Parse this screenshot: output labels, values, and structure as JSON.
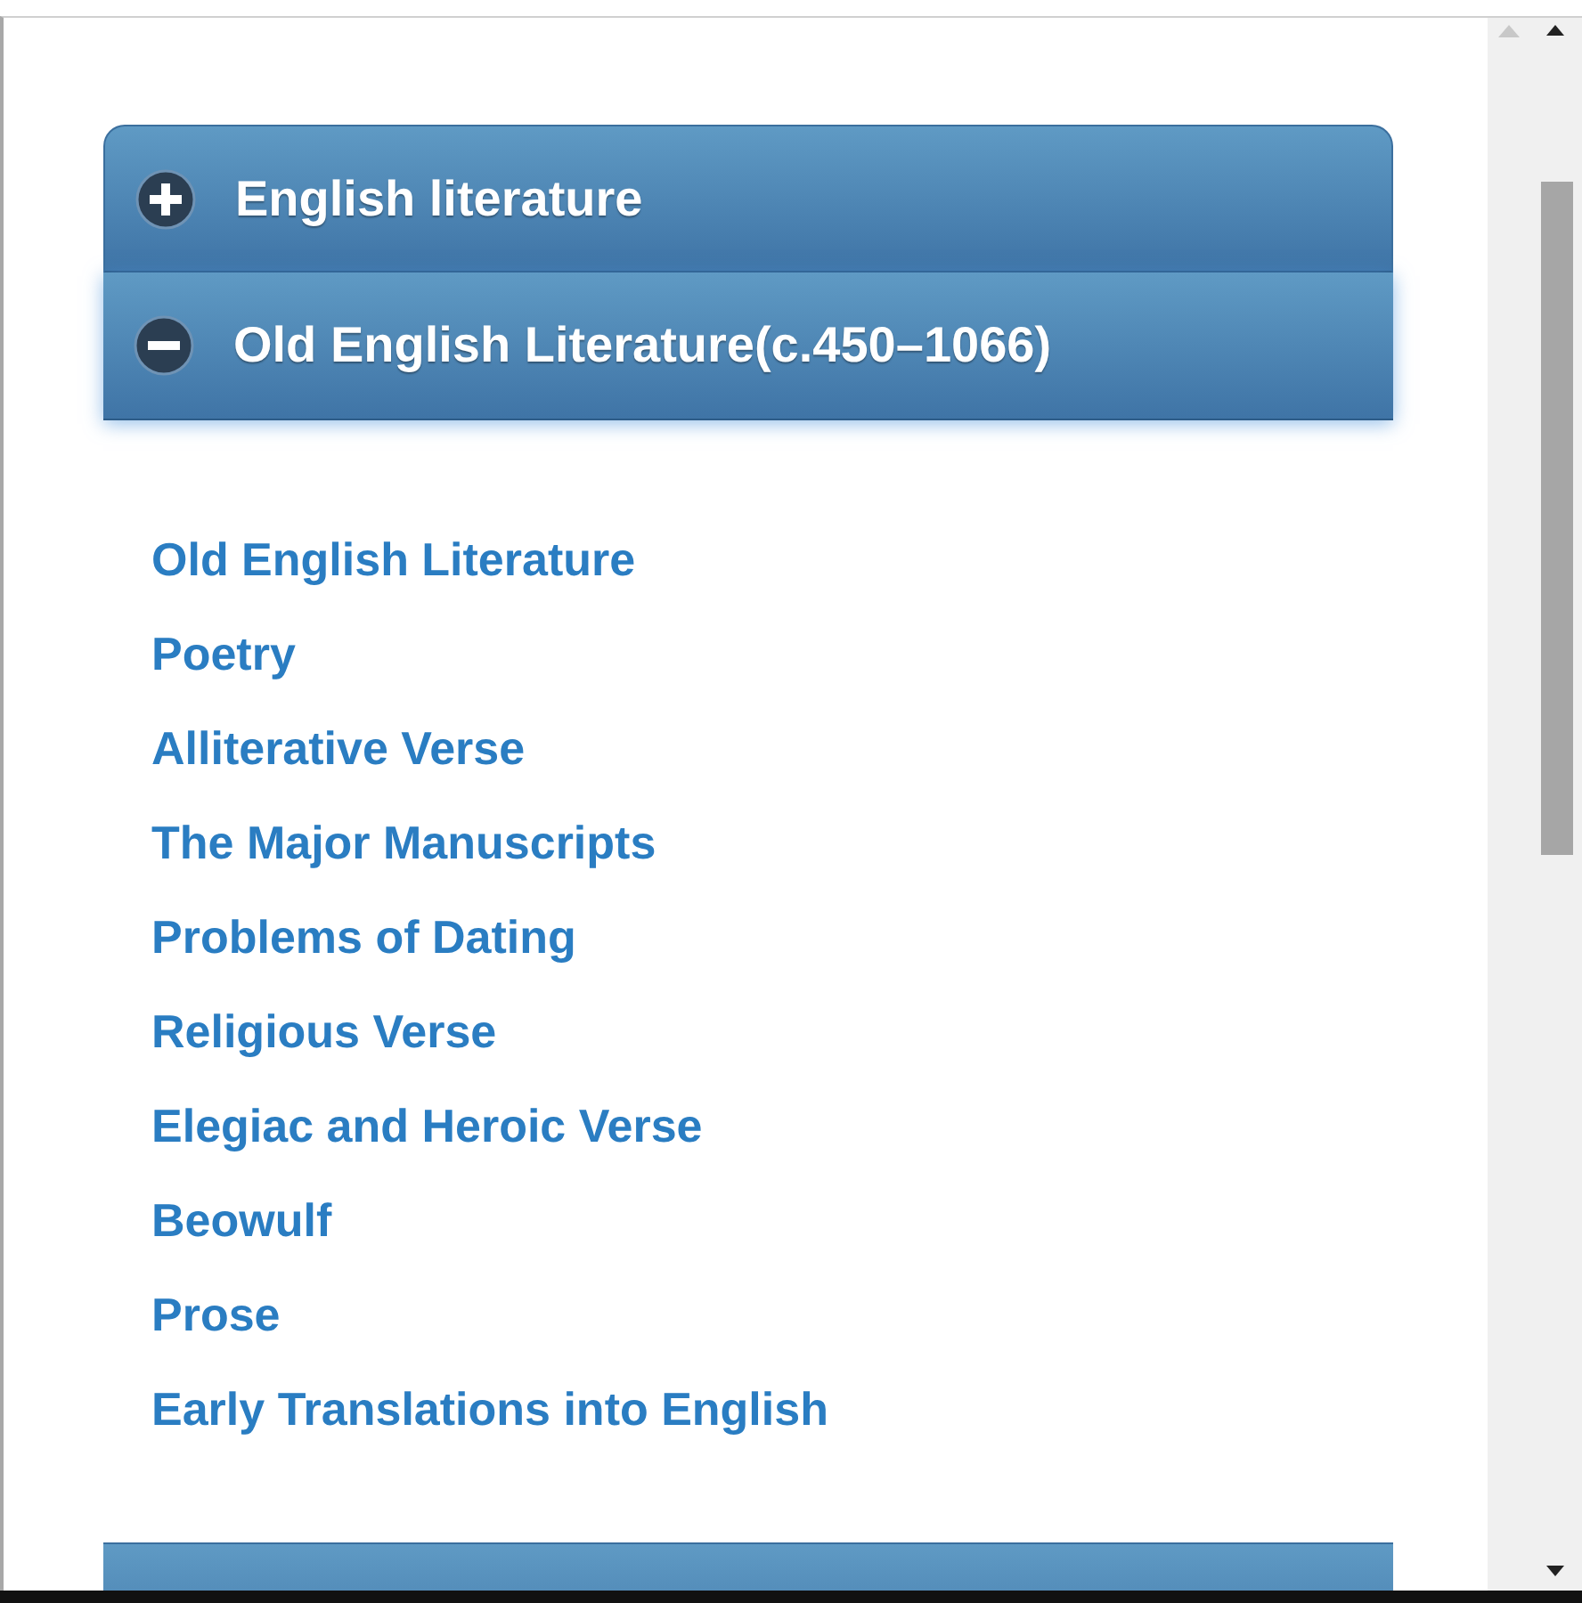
{
  "accordion": [
    {
      "title": "English literature",
      "expanded": false
    },
    {
      "title": "Old English Literature(c.450–1066)",
      "expanded": true,
      "items": [
        {
          "label": "Old English Literature"
        },
        {
          "label": "Poetry"
        },
        {
          "label": "Alliterative Verse"
        },
        {
          "label": "The Major Manuscripts"
        },
        {
          "label": "Problems of Dating"
        },
        {
          "label": "Religious Verse"
        },
        {
          "label": "Elegiac and Heroic Verse"
        },
        {
          "label": "Beowulf"
        },
        {
          "label": "Prose"
        },
        {
          "label": "Early Translations into English"
        }
      ]
    },
    {
      "kind": "cut"
    }
  ]
}
